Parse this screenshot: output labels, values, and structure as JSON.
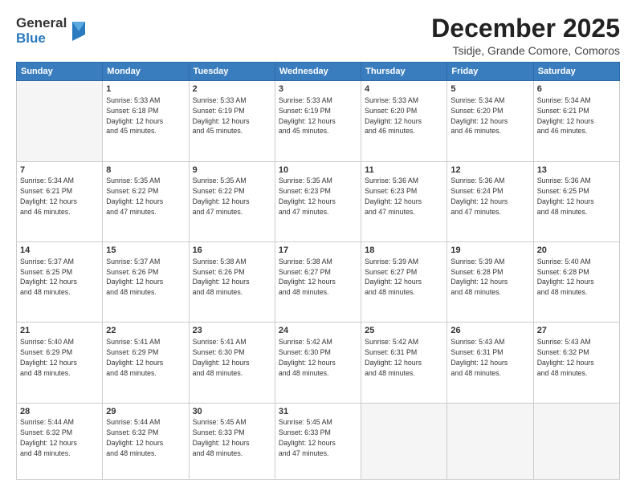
{
  "header": {
    "logo_general": "General",
    "logo_blue": "Blue",
    "main_title": "December 2025",
    "subtitle": "Tsidje, Grande Comore, Comoros"
  },
  "days_of_week": [
    "Sunday",
    "Monday",
    "Tuesday",
    "Wednesday",
    "Thursday",
    "Friday",
    "Saturday"
  ],
  "weeks": [
    [
      {
        "day": "",
        "info": ""
      },
      {
        "day": "1",
        "info": "Sunrise: 5:33 AM\nSunset: 6:18 PM\nDaylight: 12 hours\nand 45 minutes."
      },
      {
        "day": "2",
        "info": "Sunrise: 5:33 AM\nSunset: 6:19 PM\nDaylight: 12 hours\nand 45 minutes."
      },
      {
        "day": "3",
        "info": "Sunrise: 5:33 AM\nSunset: 6:19 PM\nDaylight: 12 hours\nand 45 minutes."
      },
      {
        "day": "4",
        "info": "Sunrise: 5:33 AM\nSunset: 6:20 PM\nDaylight: 12 hours\nand 46 minutes."
      },
      {
        "day": "5",
        "info": "Sunrise: 5:34 AM\nSunset: 6:20 PM\nDaylight: 12 hours\nand 46 minutes."
      },
      {
        "day": "6",
        "info": "Sunrise: 5:34 AM\nSunset: 6:21 PM\nDaylight: 12 hours\nand 46 minutes."
      }
    ],
    [
      {
        "day": "7",
        "info": "Sunrise: 5:34 AM\nSunset: 6:21 PM\nDaylight: 12 hours\nand 46 minutes."
      },
      {
        "day": "8",
        "info": "Sunrise: 5:35 AM\nSunset: 6:22 PM\nDaylight: 12 hours\nand 47 minutes."
      },
      {
        "day": "9",
        "info": "Sunrise: 5:35 AM\nSunset: 6:22 PM\nDaylight: 12 hours\nand 47 minutes."
      },
      {
        "day": "10",
        "info": "Sunrise: 5:35 AM\nSunset: 6:23 PM\nDaylight: 12 hours\nand 47 minutes."
      },
      {
        "day": "11",
        "info": "Sunrise: 5:36 AM\nSunset: 6:23 PM\nDaylight: 12 hours\nand 47 minutes."
      },
      {
        "day": "12",
        "info": "Sunrise: 5:36 AM\nSunset: 6:24 PM\nDaylight: 12 hours\nand 47 minutes."
      },
      {
        "day": "13",
        "info": "Sunrise: 5:36 AM\nSunset: 6:25 PM\nDaylight: 12 hours\nand 48 minutes."
      }
    ],
    [
      {
        "day": "14",
        "info": "Sunrise: 5:37 AM\nSunset: 6:25 PM\nDaylight: 12 hours\nand 48 minutes."
      },
      {
        "day": "15",
        "info": "Sunrise: 5:37 AM\nSunset: 6:26 PM\nDaylight: 12 hours\nand 48 minutes."
      },
      {
        "day": "16",
        "info": "Sunrise: 5:38 AM\nSunset: 6:26 PM\nDaylight: 12 hours\nand 48 minutes."
      },
      {
        "day": "17",
        "info": "Sunrise: 5:38 AM\nSunset: 6:27 PM\nDaylight: 12 hours\nand 48 minutes."
      },
      {
        "day": "18",
        "info": "Sunrise: 5:39 AM\nSunset: 6:27 PM\nDaylight: 12 hours\nand 48 minutes."
      },
      {
        "day": "19",
        "info": "Sunrise: 5:39 AM\nSunset: 6:28 PM\nDaylight: 12 hours\nand 48 minutes."
      },
      {
        "day": "20",
        "info": "Sunrise: 5:40 AM\nSunset: 6:28 PM\nDaylight: 12 hours\nand 48 minutes."
      }
    ],
    [
      {
        "day": "21",
        "info": "Sunrise: 5:40 AM\nSunset: 6:29 PM\nDaylight: 12 hours\nand 48 minutes."
      },
      {
        "day": "22",
        "info": "Sunrise: 5:41 AM\nSunset: 6:29 PM\nDaylight: 12 hours\nand 48 minutes."
      },
      {
        "day": "23",
        "info": "Sunrise: 5:41 AM\nSunset: 6:30 PM\nDaylight: 12 hours\nand 48 minutes."
      },
      {
        "day": "24",
        "info": "Sunrise: 5:42 AM\nSunset: 6:30 PM\nDaylight: 12 hours\nand 48 minutes."
      },
      {
        "day": "25",
        "info": "Sunrise: 5:42 AM\nSunset: 6:31 PM\nDaylight: 12 hours\nand 48 minutes."
      },
      {
        "day": "26",
        "info": "Sunrise: 5:43 AM\nSunset: 6:31 PM\nDaylight: 12 hours\nand 48 minutes."
      },
      {
        "day": "27",
        "info": "Sunrise: 5:43 AM\nSunset: 6:32 PM\nDaylight: 12 hours\nand 48 minutes."
      }
    ],
    [
      {
        "day": "28",
        "info": "Sunrise: 5:44 AM\nSunset: 6:32 PM\nDaylight: 12 hours\nand 48 minutes."
      },
      {
        "day": "29",
        "info": "Sunrise: 5:44 AM\nSunset: 6:32 PM\nDaylight: 12 hours\nand 48 minutes."
      },
      {
        "day": "30",
        "info": "Sunrise: 5:45 AM\nSunset: 6:33 PM\nDaylight: 12 hours\nand 48 minutes."
      },
      {
        "day": "31",
        "info": "Sunrise: 5:45 AM\nSunset: 6:33 PM\nDaylight: 12 hours\nand 47 minutes."
      },
      {
        "day": "",
        "info": ""
      },
      {
        "day": "",
        "info": ""
      },
      {
        "day": "",
        "info": ""
      }
    ]
  ]
}
